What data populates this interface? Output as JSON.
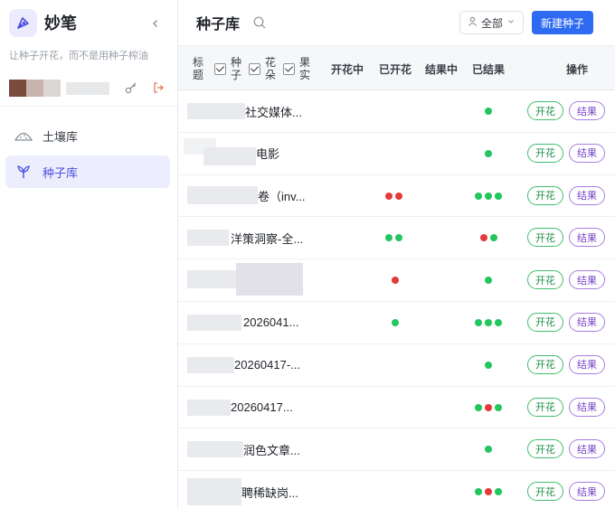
{
  "app": {
    "name": "妙笔",
    "tagline": "让种子开花，而不是用种子榨油"
  },
  "sidebar": {
    "items": [
      {
        "label": "土壤库",
        "icon": "soil-icon",
        "active": false
      },
      {
        "label": "种子库",
        "icon": "seed-icon",
        "active": true
      }
    ]
  },
  "main": {
    "title": "种子库",
    "filter_label": "全部",
    "new_button": "新建种子",
    "columns": {
      "title": "标题",
      "seed": "种子",
      "flower": "花朵",
      "fruit": "果实",
      "blooming": "开花中",
      "bloomed": "已开花",
      "fruiting": "结果中",
      "fruited": "已结果",
      "actions": "操作"
    },
    "row_actions": {
      "bloom": "开花",
      "fruit": "结果"
    },
    "rows": [
      {
        "title": "社交媒体...",
        "bloomed": [],
        "fruited": [
          "#22c55e"
        ]
      },
      {
        "title": "电影",
        "bloomed": [],
        "fruited": [
          "#22c55e"
        ]
      },
      {
        "title": "卷（inv...",
        "bloomed": [
          "#e5393b",
          "#e5393b"
        ],
        "fruited": [
          "#22c55e",
          "#22c55e",
          "#22c55e"
        ]
      },
      {
        "title": "洋策洞察-全...",
        "bloomed": [
          "#22c55e",
          "#22c55e"
        ],
        "fruited": [
          "#e5393b",
          "#22c55e"
        ]
      },
      {
        "title": "",
        "bloomed": [
          "#e5393b"
        ],
        "fruited": [
          "#22c55e"
        ]
      },
      {
        "title": "2026041...",
        "bloomed": [
          "#22c55e"
        ],
        "fruited": [
          "#22c55e",
          "#22c55e",
          "#22c55e"
        ]
      },
      {
        "title": "20260417-...",
        "bloomed": [],
        "fruited": [
          "#22c55e"
        ]
      },
      {
        "title": "20260417...",
        "bloomed": [],
        "fruited": [
          "#22c55e",
          "#e5393b",
          "#22c55e"
        ]
      },
      {
        "title": "润色文章...",
        "bloomed": [],
        "fruited": [
          "#22c55e"
        ]
      },
      {
        "title": "聘稀缺岗...",
        "bloomed": [],
        "fruited": [
          "#22c55e",
          "#e5393b",
          "#22c55e"
        ]
      }
    ]
  },
  "colors": {
    "accent": "#2f6bf2",
    "brand": "#4b4fe0",
    "status_green": "#22c55e",
    "status_red": "#e5393b",
    "bloom_tag": "#1e8f47",
    "fruit_tag": "#7a44c7"
  }
}
